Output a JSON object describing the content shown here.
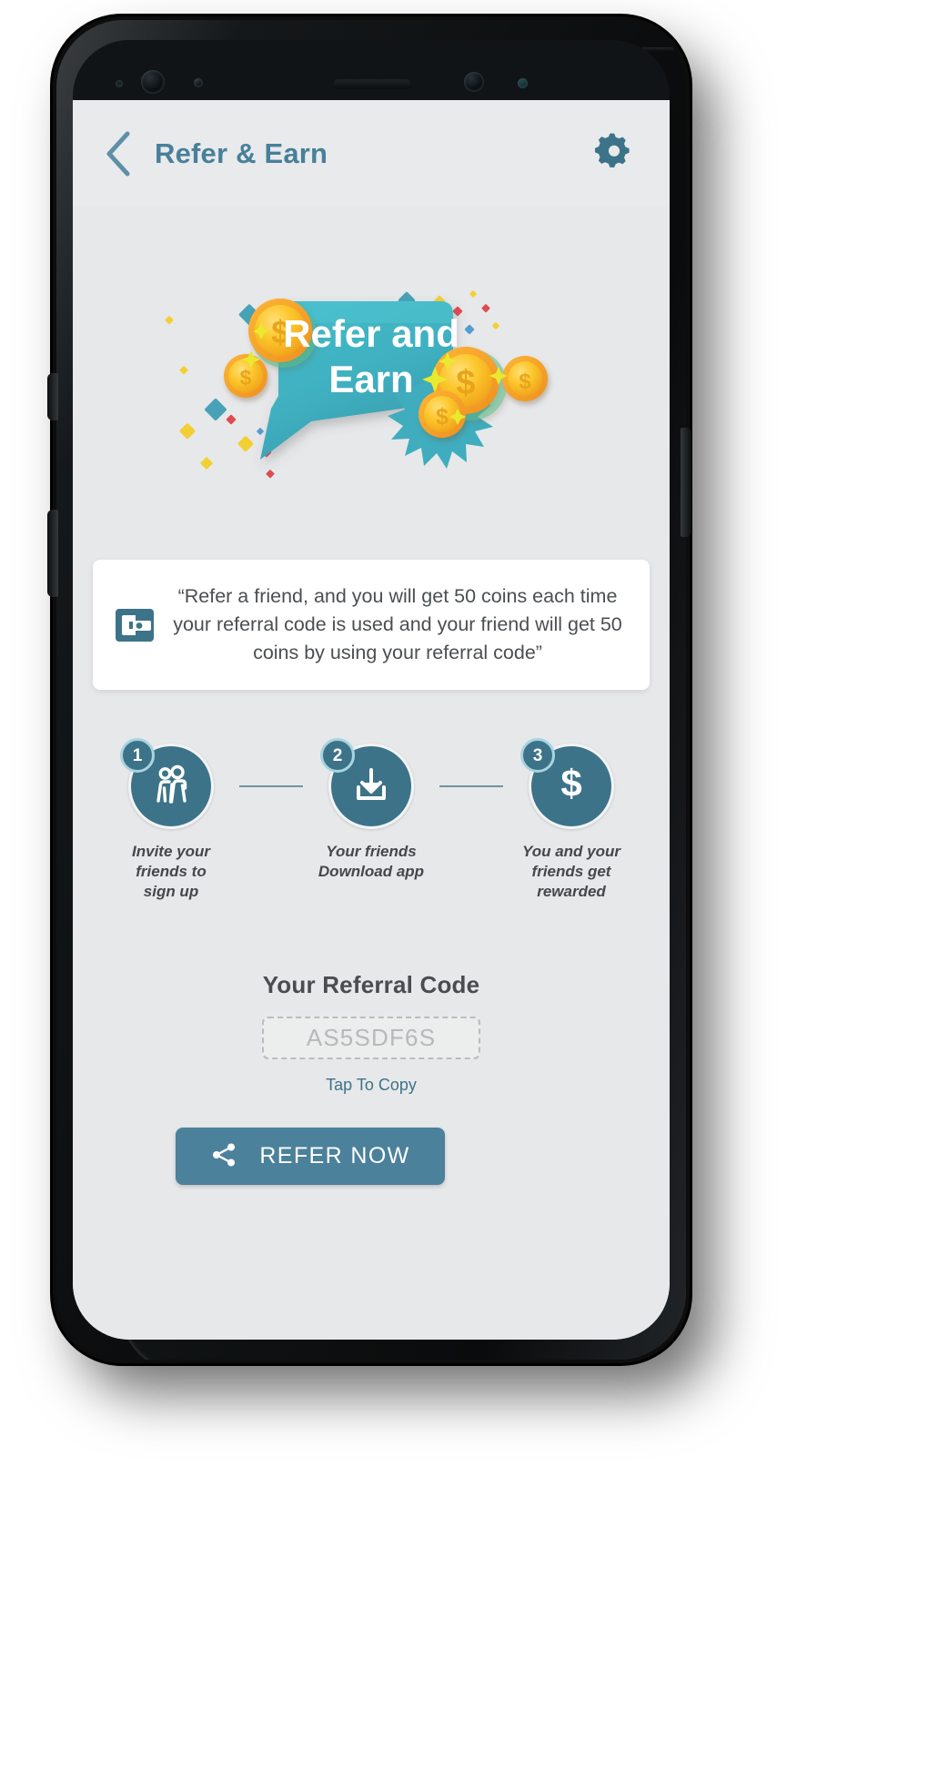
{
  "app": {
    "header": {
      "back_icon": "chevron-left-icon",
      "title": "Refer & Earn",
      "settings_icon": "gear-icon",
      "accent_color": "#47809a"
    },
    "hero": {
      "banner_icon": "refer-and-earn-speech-bubble-illustration",
      "line1": "Refer and",
      "line2": "Earn",
      "bubble_color": "#45b5c4",
      "coin_color": "#f6c330",
      "text_color": "#ffffff"
    },
    "info_card": {
      "icon": "wallet-icon",
      "icon_color": "#3d7388",
      "text": "“Refer a friend, and you will get 50 coins each time your referral code is used and your friend will get 50 coins by using your referral code”"
    },
    "steps": [
      {
        "number": "1",
        "icon": "two-people-icon",
        "label": "Invite your\nfriends to\nsign up"
      },
      {
        "number": "2",
        "icon": "download-icon",
        "label": "Your friends\nDownload app"
      },
      {
        "number": "3",
        "icon": "dollar-sign-icon",
        "label": "You and your\nfriends get\nrewarded"
      }
    ],
    "step_circle_color": "#3d7388",
    "referral": {
      "heading": "Your Referral Code",
      "code": "AS5SDF6S",
      "tap_to_copy": "Tap To Copy",
      "copy_link_color": "#3d7388"
    },
    "refer_button": {
      "icon": "share-icon",
      "label": "REFER NOW",
      "background": "#4b819b"
    }
  }
}
